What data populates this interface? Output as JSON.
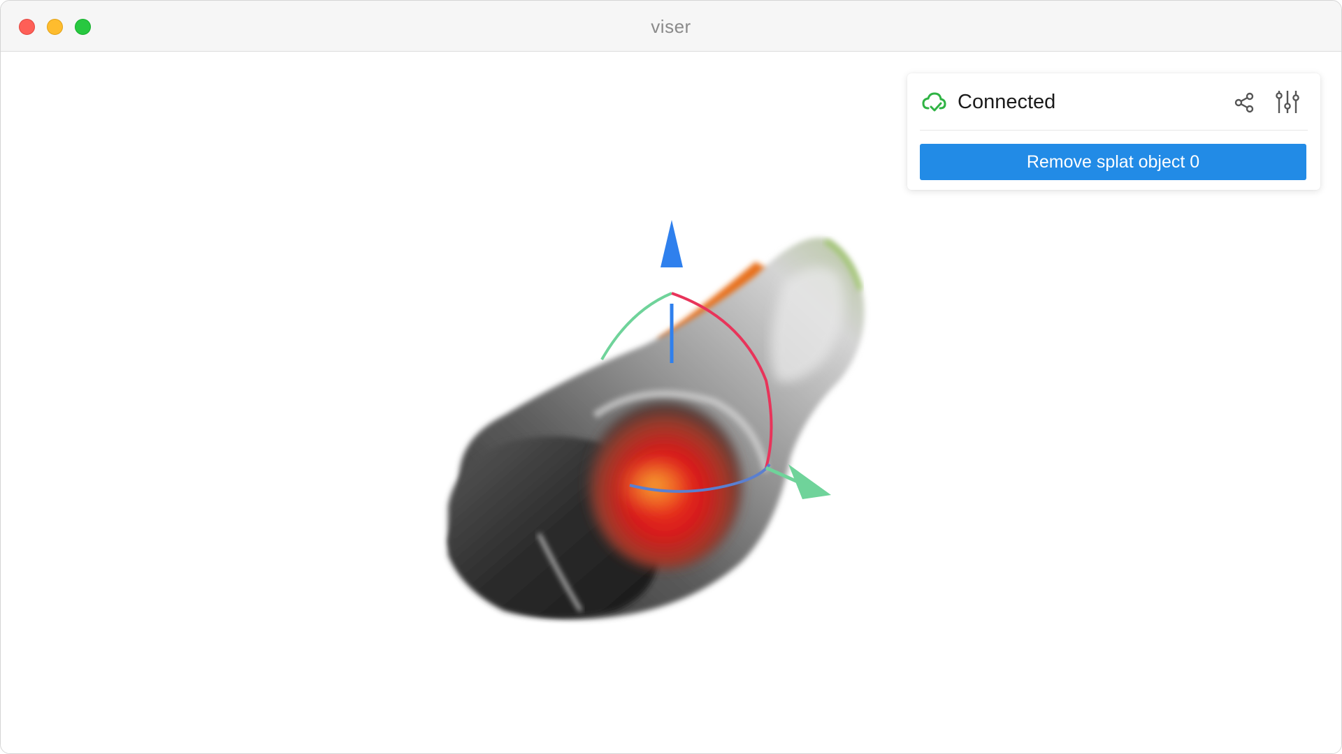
{
  "window": {
    "title": "viser",
    "controls": [
      "close",
      "minimize",
      "maximize"
    ]
  },
  "panel": {
    "status_label": "Connected",
    "status_icon": "cloud-check-icon",
    "status_color": "#2fb344",
    "share_icon": "share-icon",
    "settings_icon": "settings-sliders-icon",
    "remove_button_label": "Remove splat object 0",
    "accent_color": "#228be6"
  },
  "scene": {
    "object": "gaussian-splat",
    "gizmo": {
      "axes": [
        "x",
        "y",
        "z"
      ],
      "axis_colors": {
        "x": "#e8345a",
        "y": "#6fd39a",
        "z": "#2f80ed"
      }
    }
  }
}
